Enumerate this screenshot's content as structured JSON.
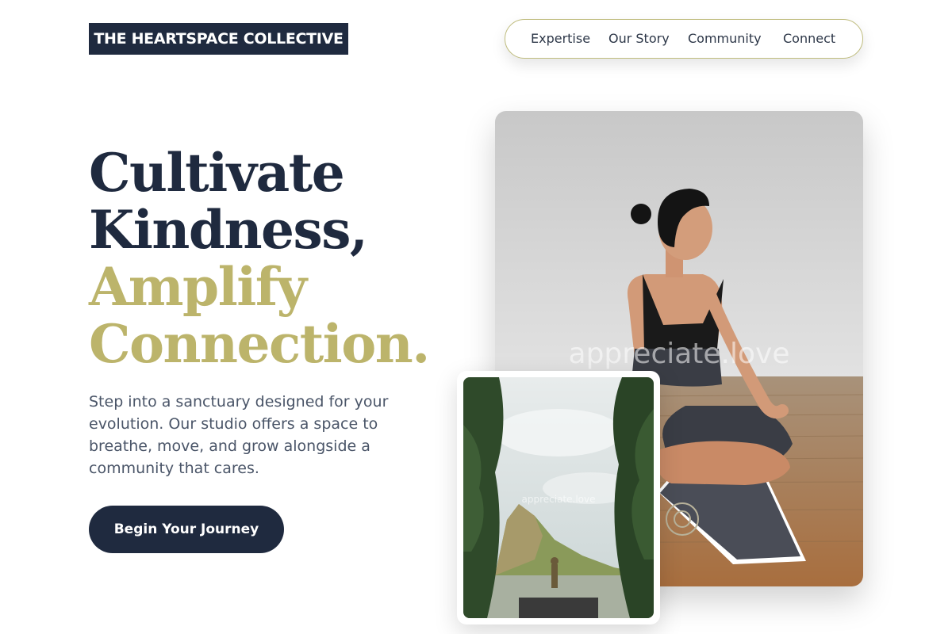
{
  "brand": {
    "name": "THE HEARTSPACE COLLECTIVE"
  },
  "nav": {
    "items": [
      "Expertise",
      "Our Story",
      "Community",
      "Connect"
    ]
  },
  "hero": {
    "headline_line1": "Cultivate",
    "headline_line2": "Kindness,",
    "headline_line3": "Amplify",
    "headline_line4": "Connection.",
    "intro": "Step into a sanctuary designed for your evolution. Our studio offers a space to breathe, move, and grow alongside a community that cares.",
    "cta_label": "Begin Your Journey"
  },
  "images": {
    "main_photo": "woman-meditating-on-yoga-mat-photo",
    "small_photo": "person-on-dock-mountain-landscape-photo",
    "watermark": "appreciate.love"
  },
  "colors": {
    "navy": "#1f2a3f",
    "gold": "#bcb46b",
    "text_gray": "#4a5568"
  }
}
